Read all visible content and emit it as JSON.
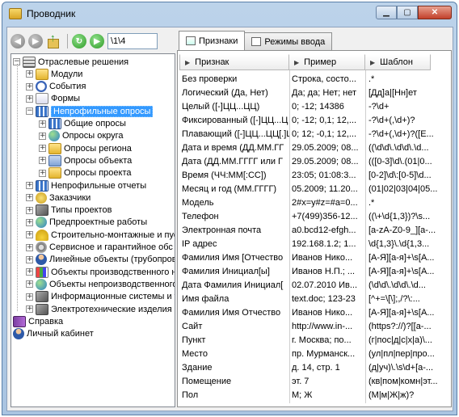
{
  "window": {
    "title": "Проводник"
  },
  "toolbar": {
    "path_value": "\\1\\4"
  },
  "tabs": [
    {
      "label": "Признаки",
      "active": true
    },
    {
      "label": "Режимы ввода",
      "active": false
    }
  ],
  "tree": {
    "root": "Отраслевые решения",
    "items": [
      {
        "label": "Модули",
        "icon": "folder-icon"
      },
      {
        "label": "События",
        "icon": "clock-icon"
      },
      {
        "label": "Формы",
        "icon": "form-icon"
      },
      {
        "label": "Непрофильные опросы",
        "icon": "grid-icon",
        "selected": true
      },
      {
        "label": "Общие опросы",
        "icon": "grid-icon",
        "child": true
      },
      {
        "label": "Опросы округа",
        "icon": "globe-icon",
        "child": true
      },
      {
        "label": "Опросы региона",
        "icon": "folder-icon",
        "child": true
      },
      {
        "label": "Опросы объекта",
        "icon": "house-icon",
        "child": true
      },
      {
        "label": "Опросы проекта",
        "icon": "folder-icon",
        "child": true
      },
      {
        "label": "Непрофильные отчеты",
        "icon": "grid-icon"
      },
      {
        "label": "Заказчики",
        "icon": "money-icon"
      },
      {
        "label": "Типы проектов",
        "icon": "link-icon"
      },
      {
        "label": "Предпроектные работы",
        "icon": "globe-icon"
      },
      {
        "label": "Строительно-монтажные и пус",
        "icon": "helmet-icon"
      },
      {
        "label": "Сервисное и гарантийное обс",
        "icon": "gear-icon"
      },
      {
        "label": "Линейные объекты (трубопров",
        "icon": "person-icon"
      },
      {
        "label": "Объекты производственного н",
        "icon": "chart-icon"
      },
      {
        "label": "Объекты непроизводственного",
        "icon": "globe-icon"
      },
      {
        "label": "Информационные системы и т",
        "icon": "lines-icon"
      },
      {
        "label": "Электротехнические изделия",
        "icon": "lines-icon"
      }
    ],
    "extra": [
      {
        "label": "Справка",
        "icon": "book-icon"
      },
      {
        "label": "Личный кабинет",
        "icon": "person-icon"
      }
    ]
  },
  "grid": {
    "columns": [
      "Признак",
      "Пример",
      "Шаблон"
    ],
    "rows": [
      [
        "Без проверки",
        "Строка, состо...",
        ".*"
      ],
      [
        "Логический (Да, Нет)",
        "Да; да; Нет; нет",
        "[Дд]а|[Нн]ет"
      ],
      [
        "Целый ([-]ЦЦ...ЦЦ)",
        "0; -12; 14386",
        "-?\\d+"
      ],
      [
        "Фиксированный ([-]ЦЦ...Ц",
        "0; -12; 0,1; 12,...",
        "-?\\d+(,\\d+)?"
      ],
      [
        "Плавающий ([-]ЦЦ...ЦЦ[.]Ц",
        "0; 12; -0,1; 12,...",
        "-?\\d+(,\\d+)?([E..."
      ],
      [
        "Дата и время (ДД.ММ.ГГ",
        "29.05.2009; 08...",
        "((\\d\\d\\.\\d\\d\\.\\d..."
      ],
      [
        "Дата (ДД.ММ.ГГГГ или Г",
        "29.05.2009; 08...",
        "(([0-3]\\d\\.(01|0..."
      ],
      [
        "Время (ЧЧ:ММ[:СС])",
        "23:05; 01:08:3...",
        "[0-2]\\d\\:[0-5]\\d..."
      ],
      [
        "Месяц и год (ММ.ГГГГ)",
        "05.2009; 11.20...",
        "(01|02|03|04|05..."
      ],
      [
        "Модель",
        "2#x=y#z=#a=0...",
        ".*"
      ],
      [
        "Телефон",
        "+7(499)356-12...",
        "((\\+\\d{1,3})?\\s..."
      ],
      [
        "Электронная почта",
        "a0.bcd12-efgh...",
        "[a-zA-Z0-9_][a-..."
      ],
      [
        "IP адрес",
        "192.168.1.2; 1...",
        "\\d{1,3}\\.\\d{1,3..."
      ],
      [
        "Фамилия Имя [Отчество",
        "Иванов Нико...",
        "[А-Я][а-я]+\\s[А..."
      ],
      [
        "Фамилия Инициал[ы]",
        "Иванов Н.П.; ...",
        "[А-Я][а-я]+\\s[А..."
      ],
      [
        "Дата Фамилия Инициал[",
        "02.07.2010 Ив...",
        "(\\d\\d\\.\\d\\d\\.\\d..."
      ],
      [
        "Имя файла",
        "text.doc; 123-23",
        "[^+=\\[\\];,/?\\:..."
      ],
      [
        "Фамилия Имя Отчество",
        "Иванов Нико...",
        "[А-Я][а-я]+\\s[А..."
      ],
      [
        "Сайт",
        "http://www.in-...",
        "(https?://)?[[a-..."
      ],
      [
        "Пункт",
        "г. Москва; по...",
        "(г|пос|д|с|х|а)\\..."
      ],
      [
        "Место",
        "пр. Мурманск...",
        "(ул|пл|пер|про..."
      ],
      [
        "Здание",
        "д. 14, стр. 1",
        "(д|уч)\\.\\s\\d+[а-..."
      ],
      [
        "Помещение",
        "эт. 7",
        "(кв|пом|комн|эт..."
      ],
      [
        "Пол",
        "М; Ж",
        "(М|м|Ж|ж)?"
      ]
    ]
  },
  "colors": {
    "selection": "#3399ff",
    "title_gradient": "#bcd3ea"
  }
}
